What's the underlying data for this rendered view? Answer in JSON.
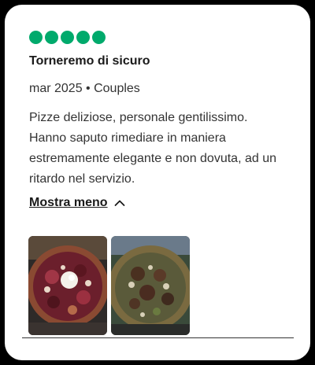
{
  "review": {
    "rating": {
      "value": 5,
      "max": 5,
      "color": "#00aa6c"
    },
    "title": "Torneremo di sicuro",
    "meta": "mar 2025 • Couples",
    "body_lines": [
      "Pizze deliziose, personale gentilissimo.",
      "Hanno saputo rimediare in maniera",
      "estremamente elegante e non dovuta, ad un",
      "ritardo nel servizio."
    ],
    "toggle_label": "Mostra meno",
    "toggle_icon": "chevron-up-icon",
    "photos": [
      {
        "name": "review-photo-1",
        "subject": "pizza"
      },
      {
        "name": "review-photo-2",
        "subject": "pizza"
      }
    ]
  }
}
